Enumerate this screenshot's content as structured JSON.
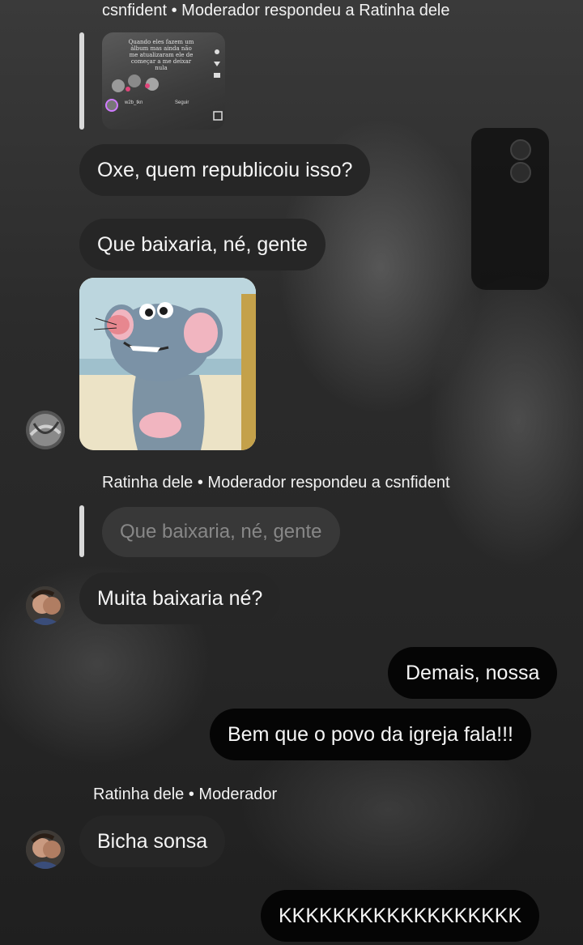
{
  "messages": {
    "reply1_meta": "csnfident • Moderador respondeu a Ratinha dele",
    "shared_post": {
      "caption": "Quando eles fazem um álbum mas ainda não me atualizaram ele de começar a me deixar nula",
      "username": "w2b_tkn",
      "follow": "Seguir"
    },
    "msg1": "Oxe, quem republicoiu isso?",
    "msg2": "Que baixaria, né, gente",
    "reply2_meta": "Ratinha dele • Moderador respondeu a csnfident",
    "reply2_quoted": "Que baixaria, né, gente",
    "msg3": "Muita baixaria né?",
    "msg4_out": "Demais, nossa",
    "msg5_out": "Bem que o povo da igreja fala!!!",
    "sender_meta": "Ratinha dele • Moderador",
    "msg6": "Bicha sonsa",
    "msg7_out": "KKKKKKKKKKKKKKKKKK"
  },
  "icons": [
    "avatar-csnfident",
    "avatar-ratinha",
    "rat-sticker"
  ]
}
